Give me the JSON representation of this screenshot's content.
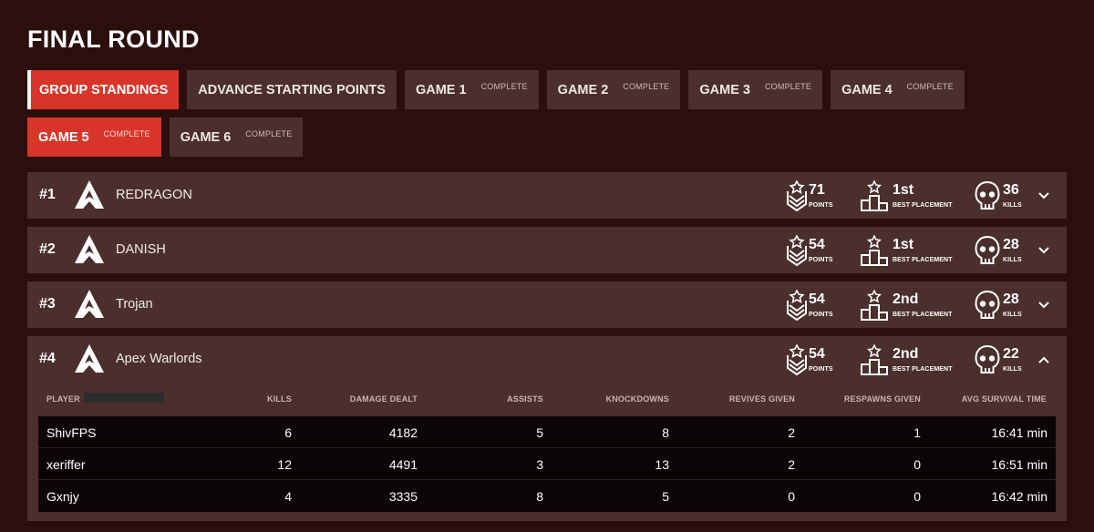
{
  "page": {
    "title": "FINAL ROUND"
  },
  "tabs": [
    [
      {
        "id": "group-standings",
        "label": "GROUP STANDINGS",
        "status": "",
        "active": true,
        "first": true
      },
      {
        "id": "advance-starting-points",
        "label": "ADVANCE STARTING POINTS",
        "status": "",
        "active": false
      },
      {
        "id": "game-1",
        "label": "GAME 1",
        "status": "COMPLETE",
        "active": false
      },
      {
        "id": "game-2",
        "label": "GAME 2",
        "status": "COMPLETE",
        "active": false
      },
      {
        "id": "game-3",
        "label": "GAME 3",
        "status": "COMPLETE",
        "active": false
      },
      {
        "id": "game-4",
        "label": "GAME 4",
        "status": "COMPLETE",
        "active": false
      }
    ],
    [
      {
        "id": "game-5",
        "label": "GAME 5",
        "status": "COMPLETE",
        "active": true
      },
      {
        "id": "game-6",
        "label": "GAME 6",
        "status": "COMPLETE",
        "active": false
      }
    ]
  ],
  "stat_labels": {
    "points": "POINTS",
    "placement": "BEST PLACEMENT",
    "kills": "KILLS"
  },
  "teams": [
    {
      "rank": "#1",
      "name": "REDRAGON",
      "points": "71",
      "best_placement": "1st",
      "kills": "36",
      "expanded": false
    },
    {
      "rank": "#2",
      "name": "DANISH",
      "points": "54",
      "best_placement": "1st",
      "kills": "28",
      "expanded": false
    },
    {
      "rank": "#3",
      "name": "Trojan",
      "points": "54",
      "best_placement": "2nd",
      "kills": "28",
      "expanded": false
    },
    {
      "rank": "#4",
      "name": "Apex Warlords",
      "points": "54",
      "best_placement": "2nd",
      "kills": "22",
      "expanded": true
    }
  ],
  "player_table": {
    "columns": [
      "PLAYER",
      "KILLS",
      "DAMAGE DEALT",
      "ASSISTS",
      "KNOCKDOWNS",
      "REVIVES GIVEN",
      "RESPAWNS GIVEN",
      "AVG SURVIVAL TIME"
    ],
    "rows": [
      [
        "ShivFPS",
        "6",
        "4182",
        "5",
        "8",
        "2",
        "1",
        "16:41 min"
      ],
      [
        "xeriffer",
        "12",
        "4491",
        "3",
        "13",
        "2",
        "0",
        "16:51 min"
      ],
      [
        "Gxnjy",
        "4",
        "3335",
        "8",
        "5",
        "0",
        "0",
        "16:42 min"
      ]
    ]
  },
  "colors": {
    "background": "#2a0f0c",
    "panel": "#4a2f2d",
    "accent": "#d8352a",
    "table_row": "#0b0605"
  },
  "icons": {
    "logo": "apex-logo-icon",
    "points": "chevron-medal-icon",
    "placement": "podium-icon",
    "kills": "skull-icon",
    "expand": "chevron-down-icon",
    "collapse": "chevron-up-icon"
  }
}
